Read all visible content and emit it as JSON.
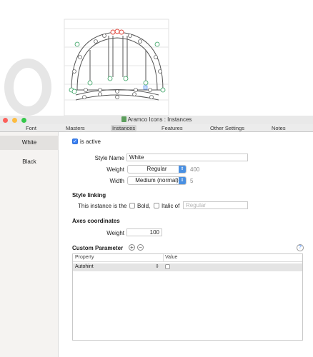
{
  "window": {
    "title": "Aramco Icons : Instances"
  },
  "tabs": [
    "Font",
    "Masters",
    "Instances",
    "Features",
    "Other Settings",
    "Notes"
  ],
  "active_tab": "Instances",
  "sidebar": {
    "items": [
      {
        "label": "White",
        "selected": true
      },
      {
        "label": "Black",
        "selected": false
      }
    ]
  },
  "instance": {
    "is_active_label": "is active",
    "is_active": true,
    "style_name_label": "Style Name",
    "style_name_value": "White",
    "weight_label": "Weight",
    "weight_selected": "Regular",
    "weight_value": "400",
    "width_label": "Width",
    "width_selected": "Medium (normal)",
    "width_value": "5"
  },
  "style_linking": {
    "heading": "Style linking",
    "text": "This instance is the",
    "bold_label": "Bold,",
    "italic_label": "Italic of",
    "of_placeholder": "Regular"
  },
  "axes": {
    "heading": "Axes coordinates",
    "weight_label": "Weight",
    "weight_value": "100"
  },
  "custom_parameter": {
    "heading": "Custom Parameter",
    "add_symbol": "+",
    "remove_symbol": "−",
    "help_symbol": "?",
    "columns": [
      "Property",
      "Value"
    ],
    "rows": [
      {
        "property": "Autohint",
        "value_checked": false
      }
    ]
  },
  "colors": {
    "accent": "#3b82f6",
    "sidebar_bg": "#f5f3f1",
    "selected_row": "#e3e1df"
  }
}
